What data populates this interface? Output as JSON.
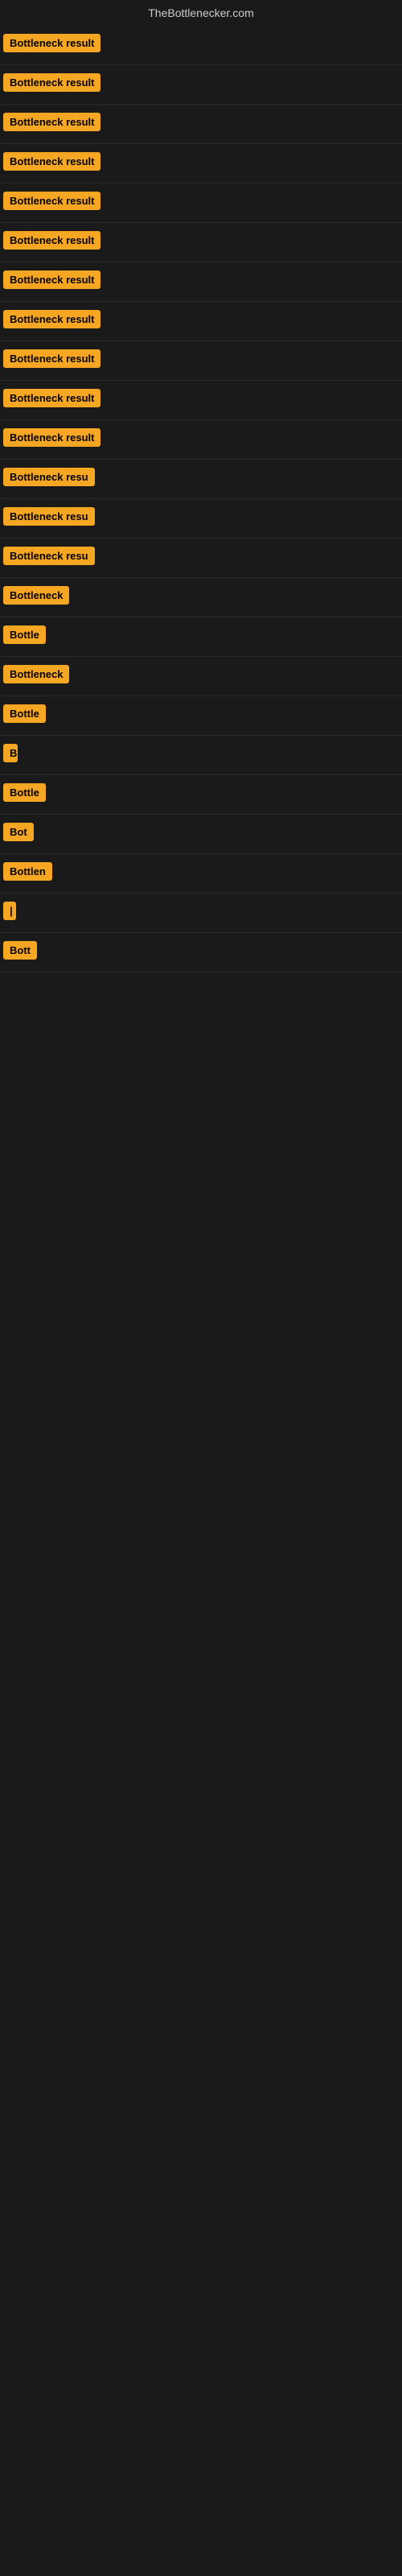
{
  "site": {
    "title": "TheBottlenecker.com"
  },
  "results": [
    {
      "id": 1,
      "label": "Bottleneck result",
      "width": 155
    },
    {
      "id": 2,
      "label": "Bottleneck result",
      "width": 155
    },
    {
      "id": 3,
      "label": "Bottleneck result",
      "width": 155
    },
    {
      "id": 4,
      "label": "Bottleneck result",
      "width": 155
    },
    {
      "id": 5,
      "label": "Bottleneck result",
      "width": 155
    },
    {
      "id": 6,
      "label": "Bottleneck result",
      "width": 155
    },
    {
      "id": 7,
      "label": "Bottleneck result",
      "width": 155
    },
    {
      "id": 8,
      "label": "Bottleneck result",
      "width": 155
    },
    {
      "id": 9,
      "label": "Bottleneck result",
      "width": 155
    },
    {
      "id": 10,
      "label": "Bottleneck result",
      "width": 155
    },
    {
      "id": 11,
      "label": "Bottleneck result",
      "width": 155
    },
    {
      "id": 12,
      "label": "Bottleneck resu",
      "width": 130
    },
    {
      "id": 13,
      "label": "Bottleneck resu",
      "width": 125
    },
    {
      "id": 14,
      "label": "Bottleneck resu",
      "width": 120
    },
    {
      "id": 15,
      "label": "Bottleneck",
      "width": 90
    },
    {
      "id": 16,
      "label": "Bottle",
      "width": 65
    },
    {
      "id": 17,
      "label": "Bottleneck",
      "width": 88
    },
    {
      "id": 18,
      "label": "Bottle",
      "width": 62
    },
    {
      "id": 19,
      "label": "B",
      "width": 18
    },
    {
      "id": 20,
      "label": "Bottle",
      "width": 60
    },
    {
      "id": 21,
      "label": "Bot",
      "width": 38
    },
    {
      "id": 22,
      "label": "Bottlen",
      "width": 72
    },
    {
      "id": 23,
      "label": "|",
      "width": 12
    },
    {
      "id": 24,
      "label": "Bott",
      "width": 50
    }
  ]
}
